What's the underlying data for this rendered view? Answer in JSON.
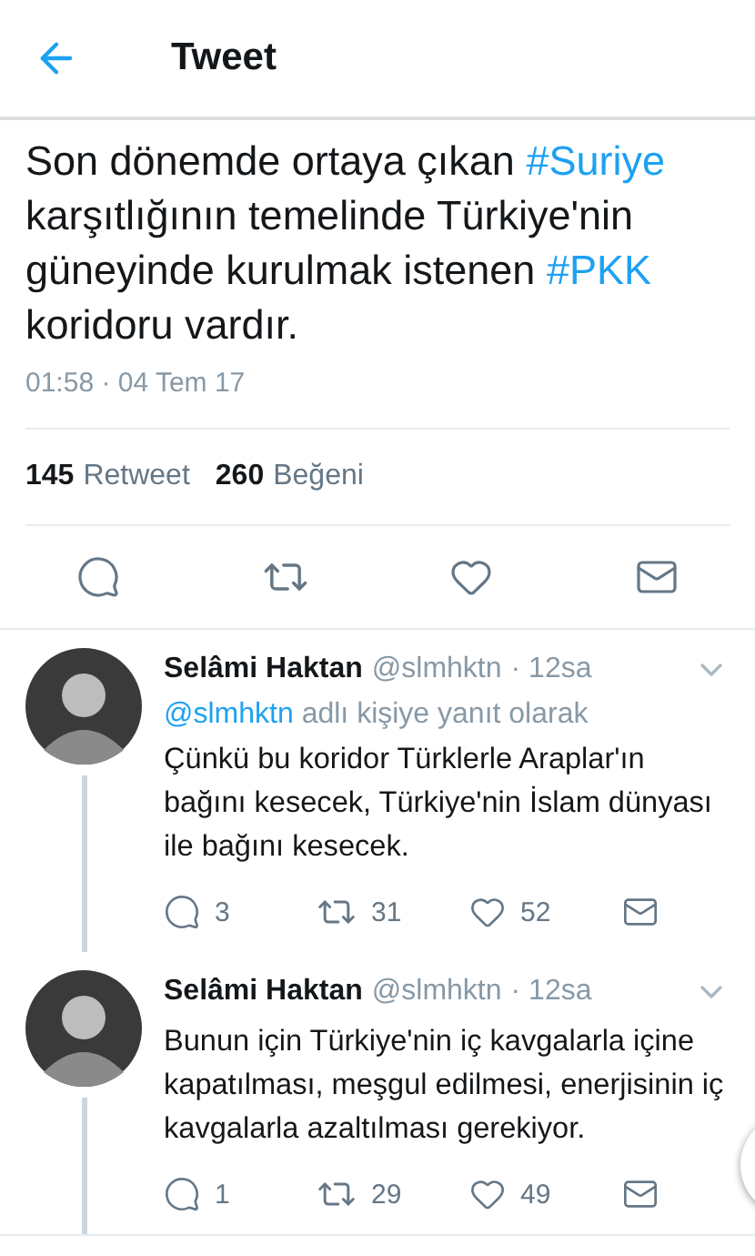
{
  "header": {
    "title": "Tweet"
  },
  "tweet": {
    "parts": [
      {
        "kind": "plain",
        "text": "Son dönemde ortaya çıkan "
      },
      {
        "kind": "hashtag",
        "text": "#Suriye"
      },
      {
        "kind": "plain",
        "text": " karşıtlığının temelinde Türkiye'nin güneyinde kurulmak istenen "
      },
      {
        "kind": "hashtag",
        "text": "#PKK"
      },
      {
        "kind": "plain",
        "text": " koridoru vardır."
      }
    ],
    "timestamp": "01:58 · 04 Tem 17",
    "stats": [
      {
        "count": "145",
        "label": "Retweet"
      },
      {
        "count": "260",
        "label": "Beğeni"
      }
    ]
  },
  "replies": [
    {
      "name": "Selâmi Haktan",
      "handle": "@slmhktn",
      "time": "· 12sa",
      "reply_to": {
        "handle": "@slmhktn",
        "text": "adlı kişiye yanıt olarak"
      },
      "text": "Çünkü bu koridor Türklerle Araplar'ın bağını kesecek, Türkiye'nin İslam dünyası ile bağını kesecek.",
      "replies": "3",
      "retweets": "31",
      "likes": "52"
    },
    {
      "name": "Selâmi Haktan",
      "handle": "@slmhktn",
      "time": "· 12sa",
      "text": "Bunun için Türkiye'nin iç kavgalarla içine kapatılması, meşgul edilmesi, enerjisinin iç kavgalarla azaltılması gerekiyor.",
      "replies": "1",
      "retweets": "29",
      "likes": "49"
    }
  ]
}
